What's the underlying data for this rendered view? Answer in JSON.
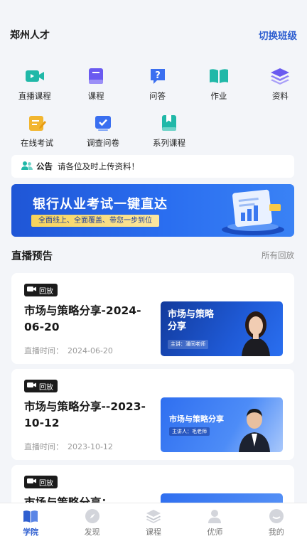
{
  "header": {
    "title": "郑州人才",
    "switch_label": "切换班级"
  },
  "menu": [
    {
      "label": "直播课程",
      "icon": "video-camera-icon",
      "color": "#20b8a8"
    },
    {
      "label": "课程",
      "icon": "book-icon",
      "color": "#6a5af0"
    },
    {
      "label": "问答",
      "icon": "question-icon",
      "color": "#3a6ff0"
    },
    {
      "label": "作业",
      "icon": "open-book-icon",
      "color": "#20b8a8"
    },
    {
      "label": "资料",
      "icon": "layers-icon",
      "color": "#6a5af0"
    },
    {
      "label": "在线考试",
      "icon": "edit-icon",
      "color": "#f2b630"
    },
    {
      "label": "调查问卷",
      "icon": "checklist-icon",
      "color": "#3a6ff0"
    },
    {
      "label": "系列课程",
      "icon": "bookmark-book-icon",
      "color": "#20b8a8"
    }
  ],
  "notice": {
    "tag": "公告",
    "message": "请各位及时上传资料！"
  },
  "banner": {
    "title": "银行从业考试一键直达",
    "subtitle": "全面线上、全面覆盖、带您一步到位"
  },
  "live_section": {
    "title": "直播预告",
    "link": "所有回放"
  },
  "cards": [
    {
      "badge": "回放",
      "title": "市场与策略分享-2024-06-20",
      "date_label": "直播时间：",
      "date": "2024-06-20",
      "thumb_title": "市场与策略\n分享",
      "thumb_sub": "主讲：潘同老师"
    },
    {
      "badge": "回放",
      "title": "市场与策略分享--2023-10-12",
      "date_label": "直播时间：",
      "date": "2023-10-12",
      "thumb_title": "市场与策略分享",
      "thumb_sub": "主讲人：毛老师"
    },
    {
      "badge": "回放",
      "title": "市场与策略分享：",
      "date_label": "",
      "date": "",
      "thumb_title": "",
      "thumb_sub": ""
    }
  ],
  "tabs": [
    {
      "label": "学院",
      "icon": "academy-icon",
      "active": true
    },
    {
      "label": "发现",
      "icon": "compass-icon",
      "active": false
    },
    {
      "label": "课程",
      "icon": "layers-icon",
      "active": false
    },
    {
      "label": "优师",
      "icon": "person-icon",
      "active": false
    },
    {
      "label": "我的",
      "icon": "chat-face-icon",
      "active": false
    }
  ],
  "colors": {
    "accent": "#2f5fd0",
    "background": "#f3f5f9"
  }
}
